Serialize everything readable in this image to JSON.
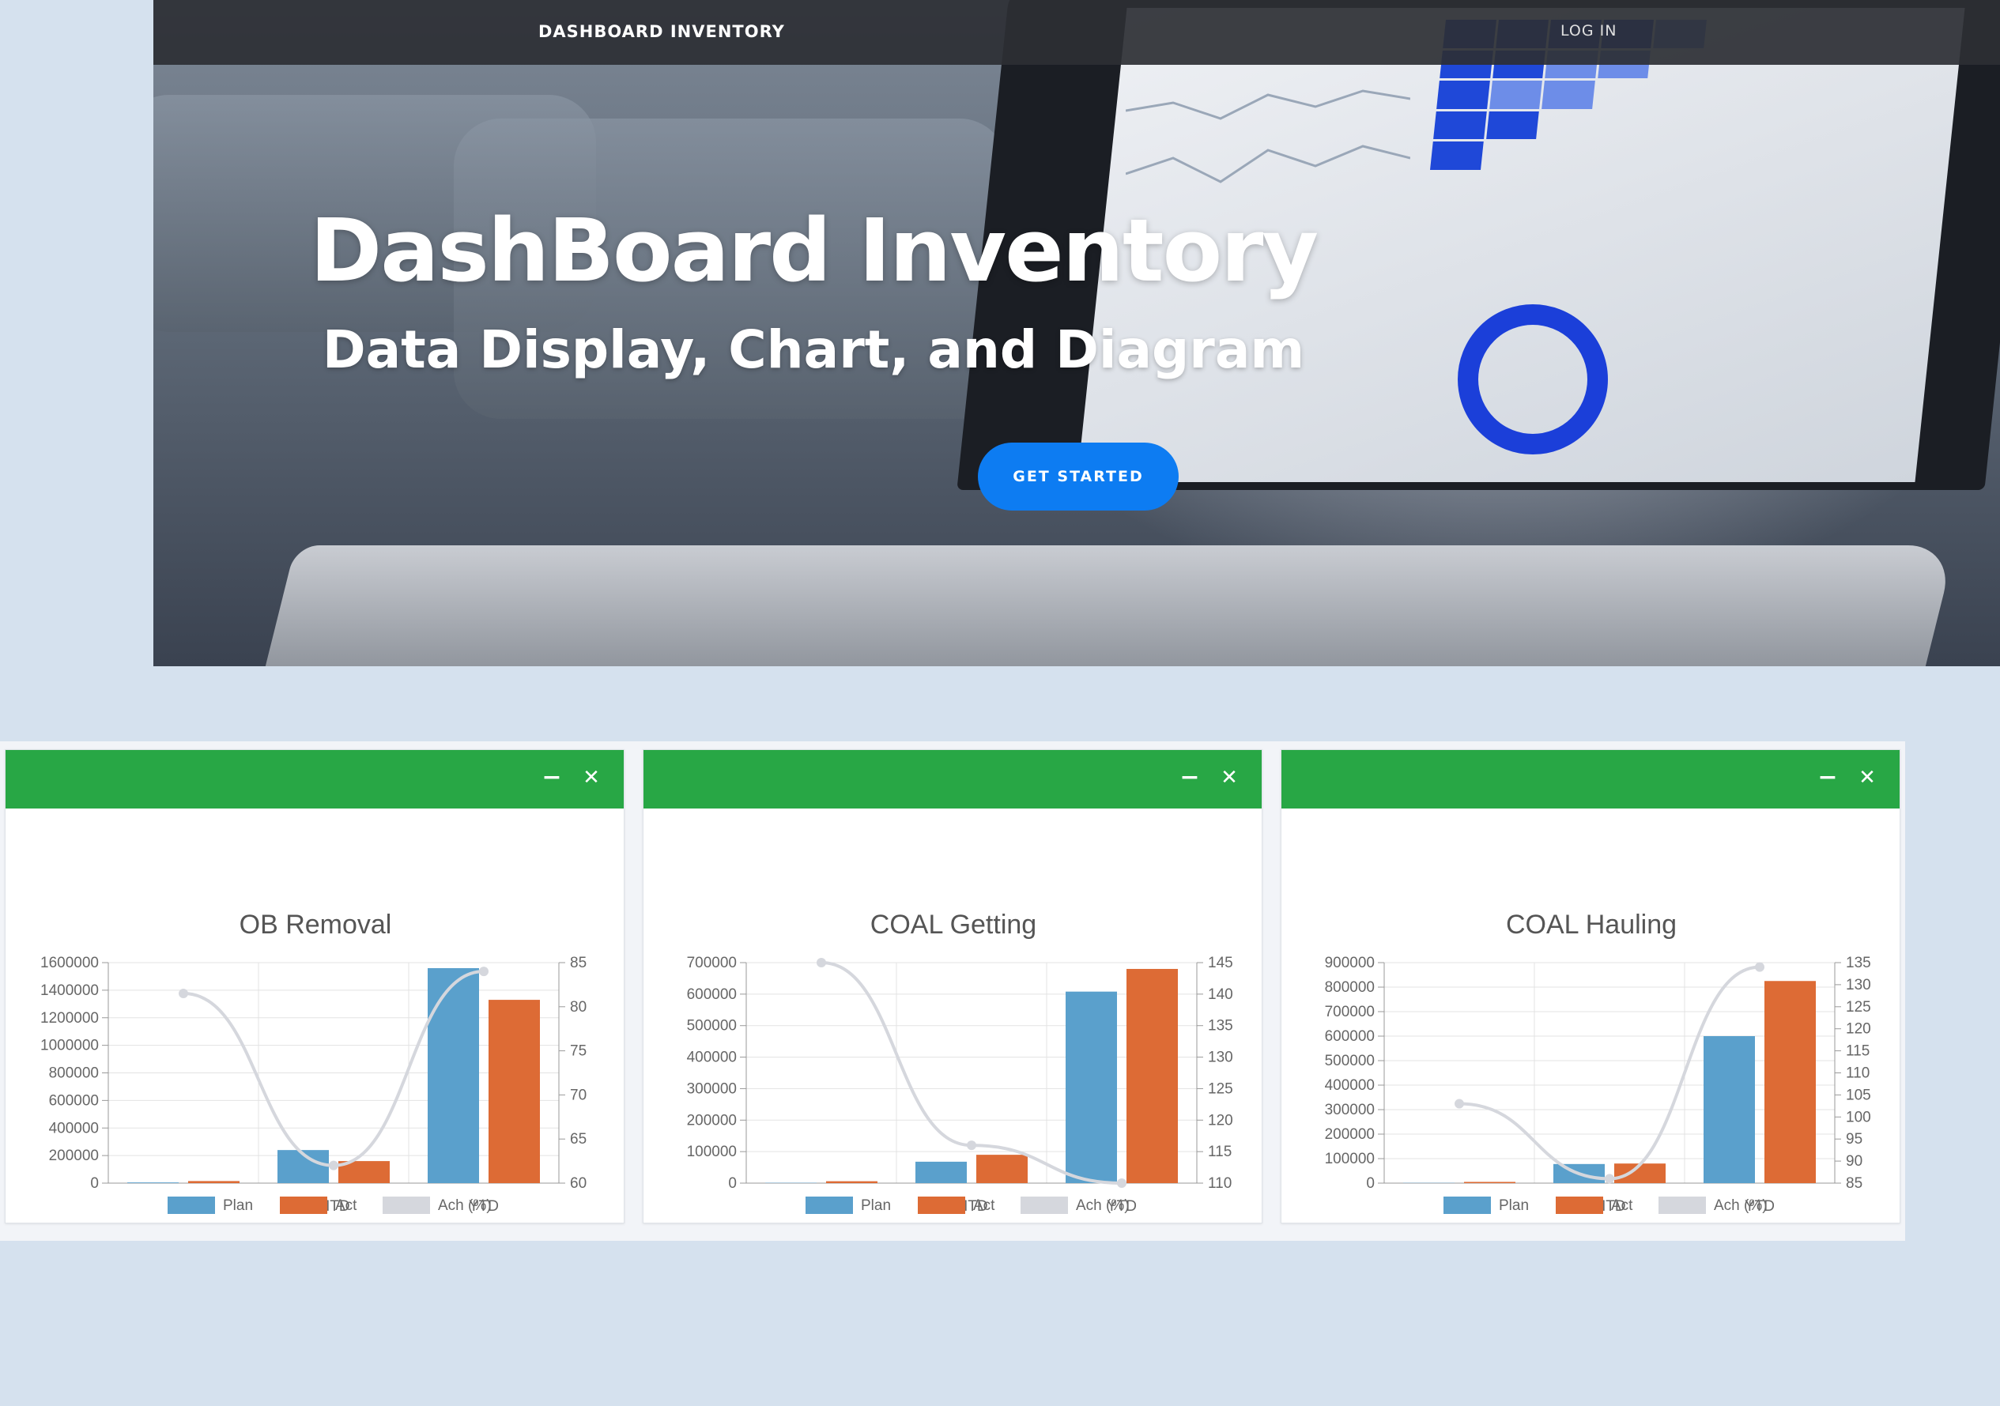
{
  "navbar": {
    "brand": "DASHBOARD INVENTORY",
    "login": "LOG IN"
  },
  "hero": {
    "title": "DashBoard Inventory",
    "subtitle": "Data Display, Chart, and Diagram",
    "cta": "GET STARTED"
  },
  "colors": {
    "plan": "#5aa0cc",
    "act": "#dd6b35",
    "ach": "#d5d7dd",
    "header": "#28a745",
    "cta": "#0d7cf2"
  },
  "icons": {
    "minimize": "minus-icon",
    "close": "close-icon"
  },
  "legend": [
    "Plan",
    "Act",
    "Ach (%)"
  ],
  "chart_data": [
    {
      "type": "bar",
      "title": "OB Removal",
      "categories": [
        "Daily",
        "MTD",
        "YTD"
      ],
      "series": [
        {
          "name": "Plan",
          "values": [
            5000,
            240000,
            1560000
          ]
        },
        {
          "name": "Act",
          "values": [
            15000,
            160000,
            1330000
          ]
        },
        {
          "name": "Ach (%)",
          "type": "line",
          "axis": "right",
          "values": [
            81.5,
            62,
            84
          ]
        }
      ],
      "y_left": {
        "min": 0,
        "max": 1600000,
        "ticks": [
          0,
          200000,
          400000,
          600000,
          800000,
          1000000,
          1200000,
          1400000,
          1600000
        ]
      },
      "y_right": {
        "min": 60,
        "max": 85,
        "ticks": [
          60,
          65,
          70,
          75,
          80,
          85
        ]
      },
      "grid": true,
      "legend_position": "bottom"
    },
    {
      "type": "bar",
      "title": "COAL Getting",
      "categories": [
        "Daily",
        "MTD",
        "YTD"
      ],
      "series": [
        {
          "name": "Plan",
          "values": [
            1000,
            68000,
            608000
          ]
        },
        {
          "name": "Act",
          "values": [
            6000,
            90000,
            680000
          ]
        },
        {
          "name": "Ach (%)",
          "type": "line",
          "axis": "right",
          "values": [
            145,
            116,
            110
          ]
        }
      ],
      "y_left": {
        "min": 0,
        "max": 700000,
        "ticks": [
          0,
          100000,
          200000,
          300000,
          400000,
          500000,
          600000,
          700000
        ]
      },
      "y_right": {
        "min": 110,
        "max": 145,
        "ticks": [
          110,
          115,
          120,
          125,
          130,
          135,
          140,
          145
        ]
      },
      "grid": true,
      "legend_position": "bottom"
    },
    {
      "type": "bar",
      "title": "COAL Hauling",
      "categories": [
        "Daily",
        "MTD",
        "YTD"
      ],
      "series": [
        {
          "name": "Plan",
          "values": [
            1000,
            78000,
            600000
          ]
        },
        {
          "name": "Act",
          "values": [
            5000,
            80000,
            825000
          ]
        },
        {
          "name": "Ach (%)",
          "type": "line",
          "axis": "right",
          "values": [
            103,
            86,
            134
          ]
        }
      ],
      "y_left": {
        "min": 0,
        "max": 900000,
        "ticks": [
          0,
          100000,
          200000,
          300000,
          400000,
          500000,
          600000,
          700000,
          800000,
          900000
        ]
      },
      "y_right": {
        "min": 85,
        "max": 135,
        "ticks": [
          85,
          90,
          95,
          100,
          105,
          110,
          115,
          120,
          125,
          130,
          135
        ]
      },
      "grid": true,
      "legend_position": "bottom"
    }
  ]
}
